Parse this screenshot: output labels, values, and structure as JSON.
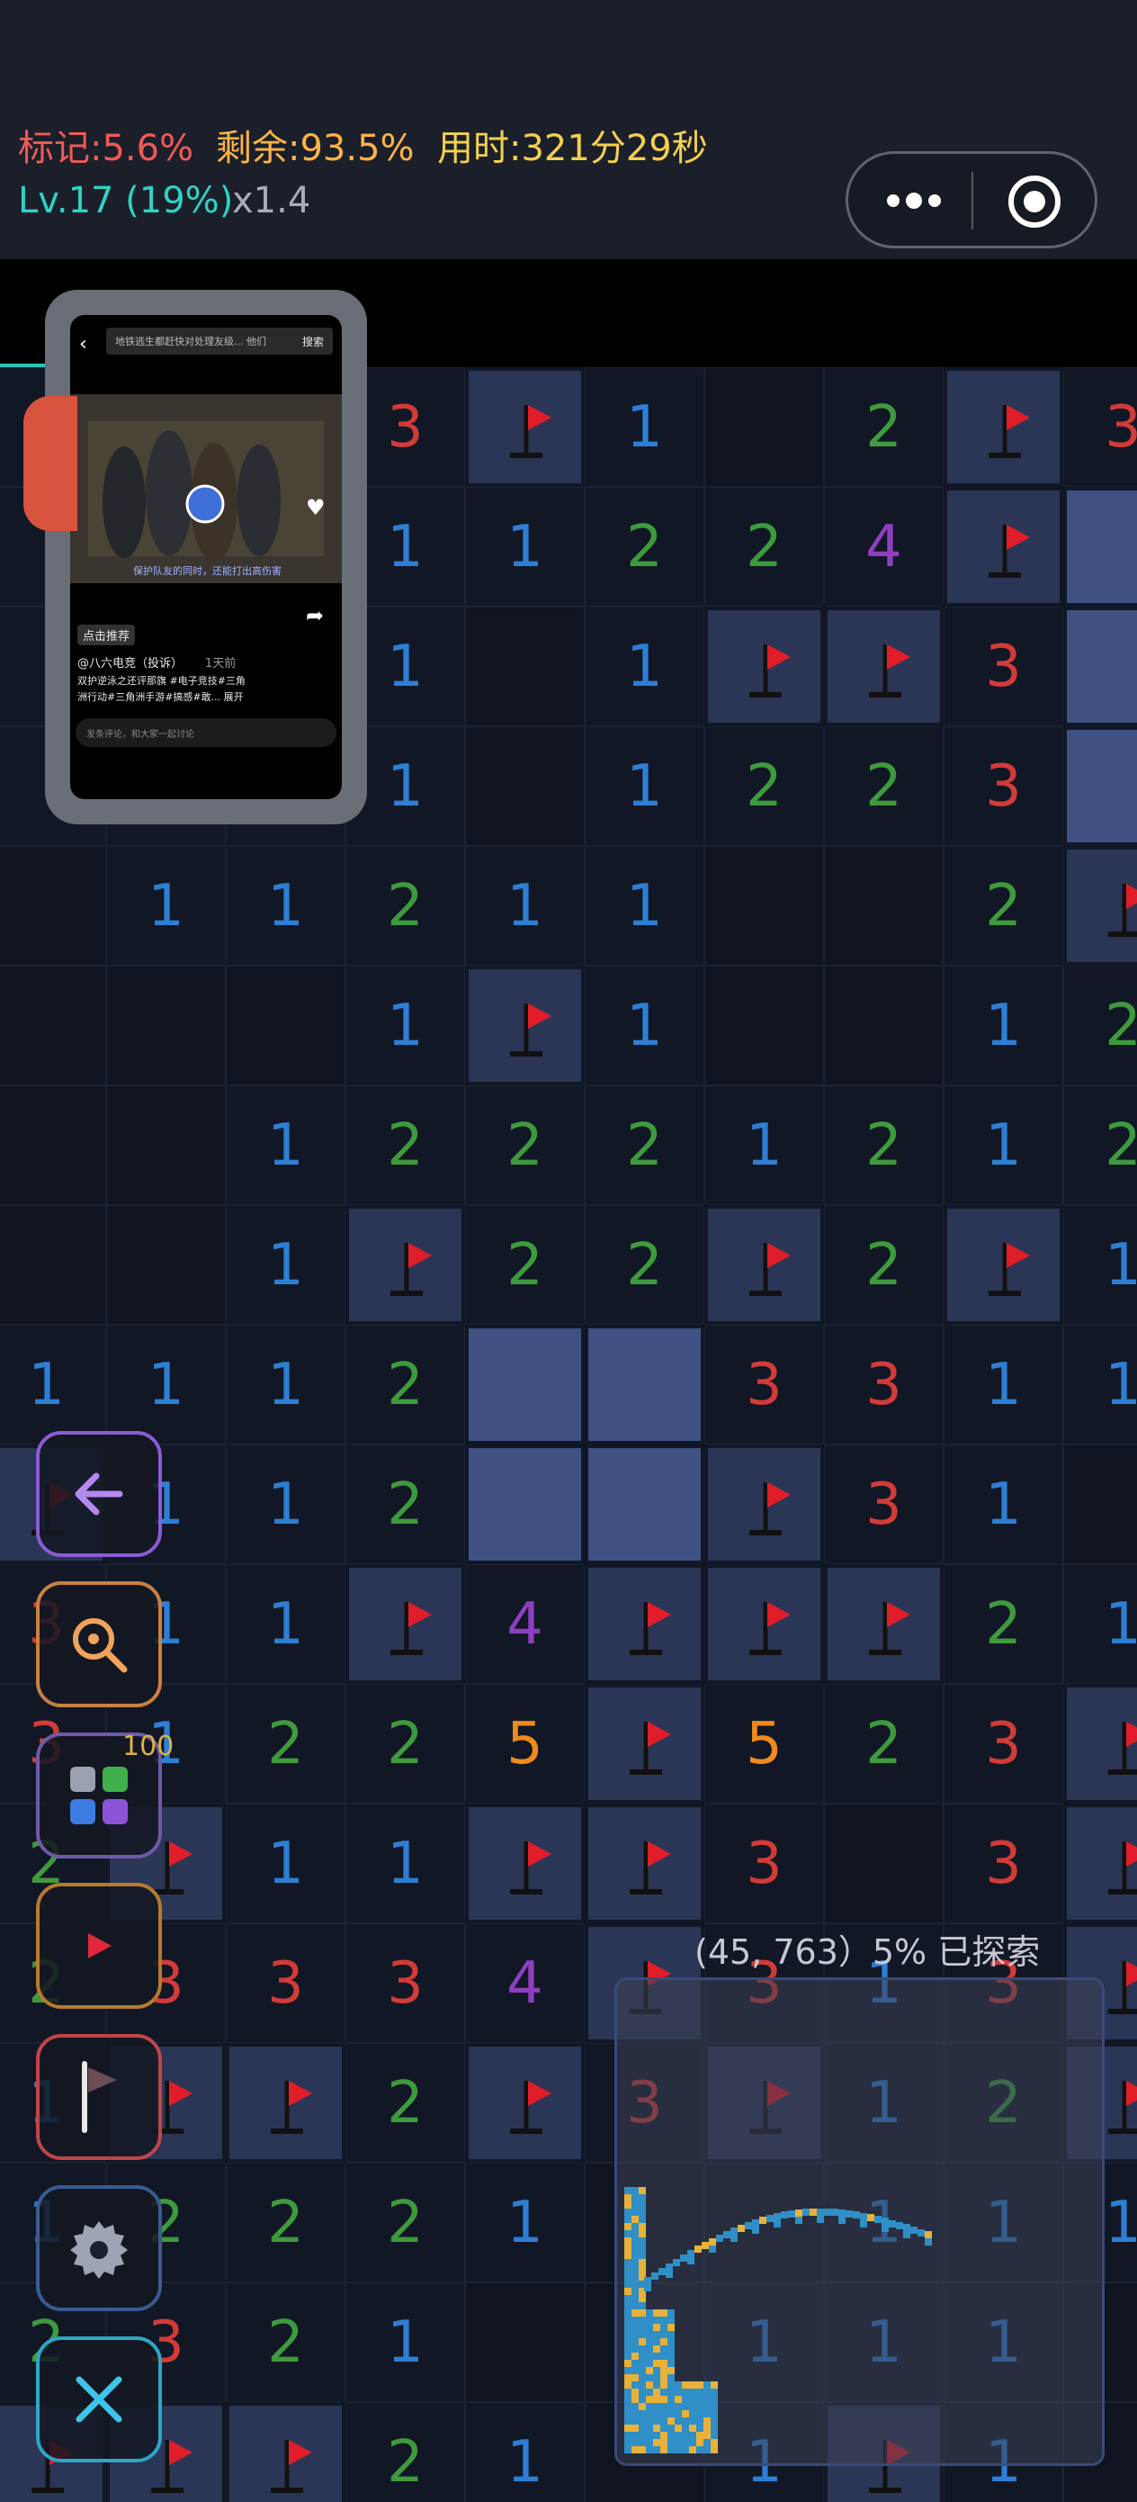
{
  "header": {
    "mark": "标记:5.6%",
    "remaining": "剩余:93.5%",
    "time": "用时:321分29秒",
    "level": "Lv.17 (19%)",
    "zoom": "x1.4",
    "colors": {
      "mark": "#ef5a57",
      "remaining": "#ffb347",
      "time": "#f3d04f",
      "level": "#2ed3c5",
      "zoom": "#a9adb6"
    }
  },
  "capsule": {
    "more_icon": "more-dots-icon",
    "close_icon": "record-circle-icon"
  },
  "board": {
    "rows": [
      [
        "?",
        "?",
        "?",
        "3",
        "F",
        "1",
        "",
        "2",
        "F",
        "3"
      ],
      [
        "?",
        "?",
        "?",
        "1",
        "1",
        "2",
        "2",
        "4",
        "F",
        "H"
      ],
      [
        "?",
        "?",
        "?",
        "1",
        "",
        "1",
        "F",
        "F",
        "3",
        "H"
      ],
      [
        "?",
        "?",
        "?",
        "1",
        "",
        "1",
        "2",
        "2",
        "3",
        "H"
      ],
      [
        "",
        "1",
        "1",
        "2",
        "1",
        "1",
        "",
        "",
        "2",
        "F"
      ],
      [
        "",
        "",
        "",
        "1",
        "F",
        "1",
        "",
        "",
        "1",
        "2"
      ],
      [
        "",
        "",
        "1",
        "2",
        "2",
        "2",
        "1",
        "2",
        "1",
        "2"
      ],
      [
        "",
        "",
        "1",
        "F",
        "2",
        "2",
        "F",
        "2",
        "F",
        "1"
      ],
      [
        "1",
        "1",
        "1",
        "2",
        "H",
        "H",
        "3",
        "3",
        "1",
        "1"
      ],
      [
        "F",
        "1",
        "1",
        "2",
        "H",
        "H",
        "F",
        "3",
        "1",
        ""
      ],
      [
        "3",
        "1",
        "1",
        "F",
        "4",
        "F",
        "F",
        "F",
        "2",
        "1"
      ],
      [
        "3",
        "1",
        "2",
        "2",
        "5",
        "F",
        "5",
        "2",
        "3",
        "F"
      ],
      [
        "2",
        "F",
        "1",
        "1",
        "F",
        "F",
        "3",
        "",
        "3",
        "F"
      ],
      [
        "2",
        "3",
        "3",
        "3",
        "4",
        "F",
        "3",
        "1",
        "3",
        "F"
      ],
      [
        "1",
        "F",
        "F",
        "2",
        "F",
        "3",
        "F",
        "1",
        "2",
        "F"
      ],
      [
        "1",
        "2",
        "2",
        "2",
        "1",
        "",
        "",
        "1",
        "1",
        "1"
      ],
      [
        "2",
        "3",
        "2",
        "1",
        "",
        "",
        "1",
        "1",
        "1",
        ""
      ],
      [
        "F",
        "F",
        "F",
        "2",
        "1",
        "",
        "1",
        "F",
        "1",
        ""
      ]
    ],
    "number_colors": {
      "1": "#2d7fd4",
      "2": "#3e9b3d",
      "3": "#d23b37",
      "4": "#8e3fc1",
      "5": "#f08a1c"
    }
  },
  "minimap": {
    "label": "(45, 763）5% 已探索"
  },
  "toolbar": [
    {
      "name": "back-button",
      "icon": "arrow-left-icon",
      "color": "#8a5cd6"
    },
    {
      "name": "zoom-button",
      "icon": "magnifier-icon",
      "color": "#c9813e"
    },
    {
      "name": "apps-button",
      "icon": "grid-apps-icon",
      "color": "#6e5aa8",
      "badge": "100"
    },
    {
      "name": "video-button",
      "icon": "play-icon",
      "color": "#b87a2f"
    },
    {
      "name": "flag-mode-button",
      "icon": "flag-outline-icon",
      "color": "#c0454a"
    },
    {
      "name": "settings-button",
      "icon": "gear-icon",
      "color": "#3b5b8f"
    },
    {
      "name": "close-button",
      "icon": "close-icon",
      "color": "#2ea6c8"
    }
  ],
  "pip": {
    "search_text": "地铁逃生都赶快对处理友级... 他们",
    "search_btn": "搜索",
    "caption": "@八六电竞（投诉）",
    "time_ago": "1天前",
    "desc1": "双护逆泳之还评那旗 #电子竞技#三角",
    "desc2": "洲行动#三角洲手游#搞感#敢... 展开",
    "subtitle": "保护队友的同时，还能打出高伤害",
    "tag": "点击推荐",
    "comment_placeholder": "发条评论，和大家一起讨论"
  }
}
